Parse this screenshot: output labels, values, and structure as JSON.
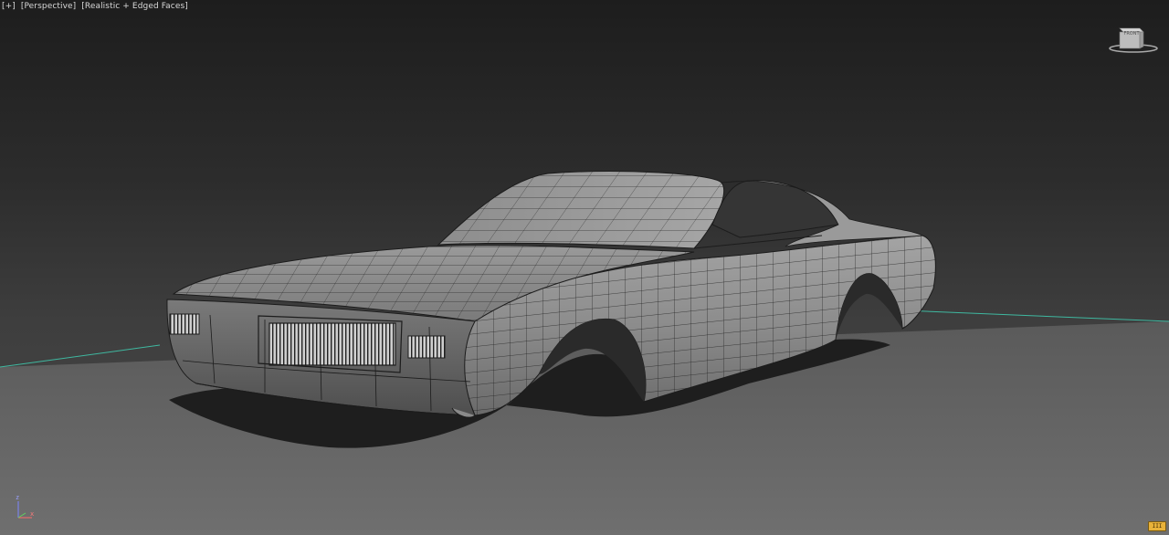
{
  "viewport": {
    "labels": [
      "[+]",
      "[Perspective]",
      "[Realistic + Edged Faces]"
    ]
  },
  "viewcube": {
    "face_label": "FRONT"
  },
  "axis_tripod": {
    "z_label": "z",
    "x_label": "x"
  },
  "stats_button": {
    "label": "III"
  },
  "colors": {
    "grid_line": "#3fb8a0",
    "ground": "#6c6c6c",
    "car_body": "#8a8a8a",
    "wireframe": "#222222",
    "shadow": "#1a1a1a",
    "stats_button": "#e8b23a"
  },
  "icons": [
    "viewcube-icon",
    "axis-tripod-icon",
    "stats-icon"
  ]
}
